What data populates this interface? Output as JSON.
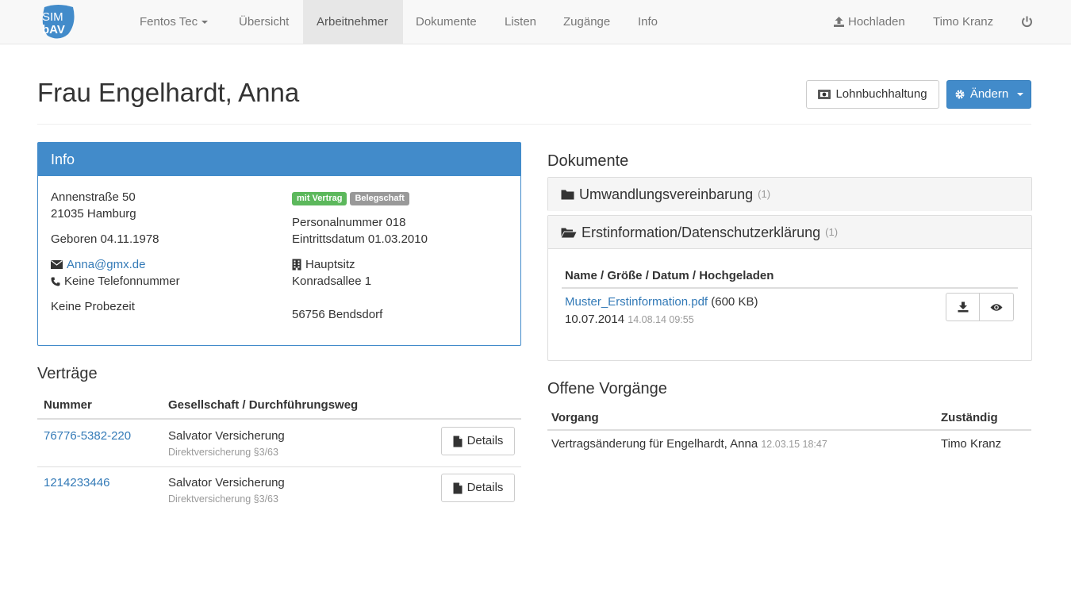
{
  "app": {
    "logo_text_top": "SIM",
    "logo_text_bottom": "bAV",
    "brand_color": "#428bca"
  },
  "nav": {
    "items": [
      {
        "label": "Fentos Tec",
        "dropdown": true
      },
      {
        "label": "Übersicht"
      },
      {
        "label": "Arbeitnehmer",
        "active": true
      },
      {
        "label": "Dokumente"
      },
      {
        "label": "Listen"
      },
      {
        "label": "Zugänge"
      },
      {
        "label": "Info"
      }
    ],
    "upload_label": "Hochladen",
    "user_name": "Timo Kranz",
    "power_icon": "power-icon"
  },
  "page": {
    "title": "Frau Engelhardt, Anna",
    "payroll_button": "Lohnbuchhaltung",
    "change_button": "Ändern"
  },
  "info": {
    "title": "Info",
    "street": "Annenstraße 50",
    "city": "21035 Hamburg",
    "birth": "Geboren 04.11.1978",
    "email": "Anna@gmx.de",
    "phone": "Keine Telefonnummer",
    "probation": "Keine Probezeit",
    "badge_contract": "mit Vertrag",
    "badge_staff": "Belegschaft",
    "personnel_number": "Personalnummer 018",
    "entry_date": "Eintrittsdatum 01.03.2010",
    "site_name": "Hauptsitz",
    "site_street": "Konradsallee 1",
    "site_city": "56756 Bendsdorf"
  },
  "contracts": {
    "title": "Verträge",
    "col_number": "Nummer",
    "col_company": "Gesellschaft / Durchführungsweg",
    "rows": [
      {
        "number": "76776-5382-220",
        "company": "Salvator Versicherung",
        "type": "Direktversicherung §3/63",
        "button": "Details"
      },
      {
        "number": "1214233446",
        "company": "Salvator Versicherung",
        "type": "Direktversicherung §3/63",
        "button": "Details"
      }
    ]
  },
  "documents": {
    "title": "Dokumente",
    "folders": [
      {
        "name": "Umwandlungsvereinbarung",
        "count": "(1)"
      },
      {
        "name": "Erstinformation/Datenschutzerklärung",
        "count": "(1)"
      }
    ],
    "table_header": "Name / Größe / Datum / Hochgeladen",
    "file": {
      "name": "Muster_Erstinformation.pdf",
      "size": "(600 KB)",
      "date": "10.07.2014",
      "uploaded": "14.08.14 09:55"
    }
  },
  "processes": {
    "title": "Offene Vorgänge",
    "col_process": "Vorgang",
    "col_responsible": "Zuständig",
    "rows": [
      {
        "process": "Vertragsänderung für Engelhardt, Anna",
        "timestamp": "12.03.15 18:47",
        "responsible": "Timo Kranz"
      }
    ]
  }
}
